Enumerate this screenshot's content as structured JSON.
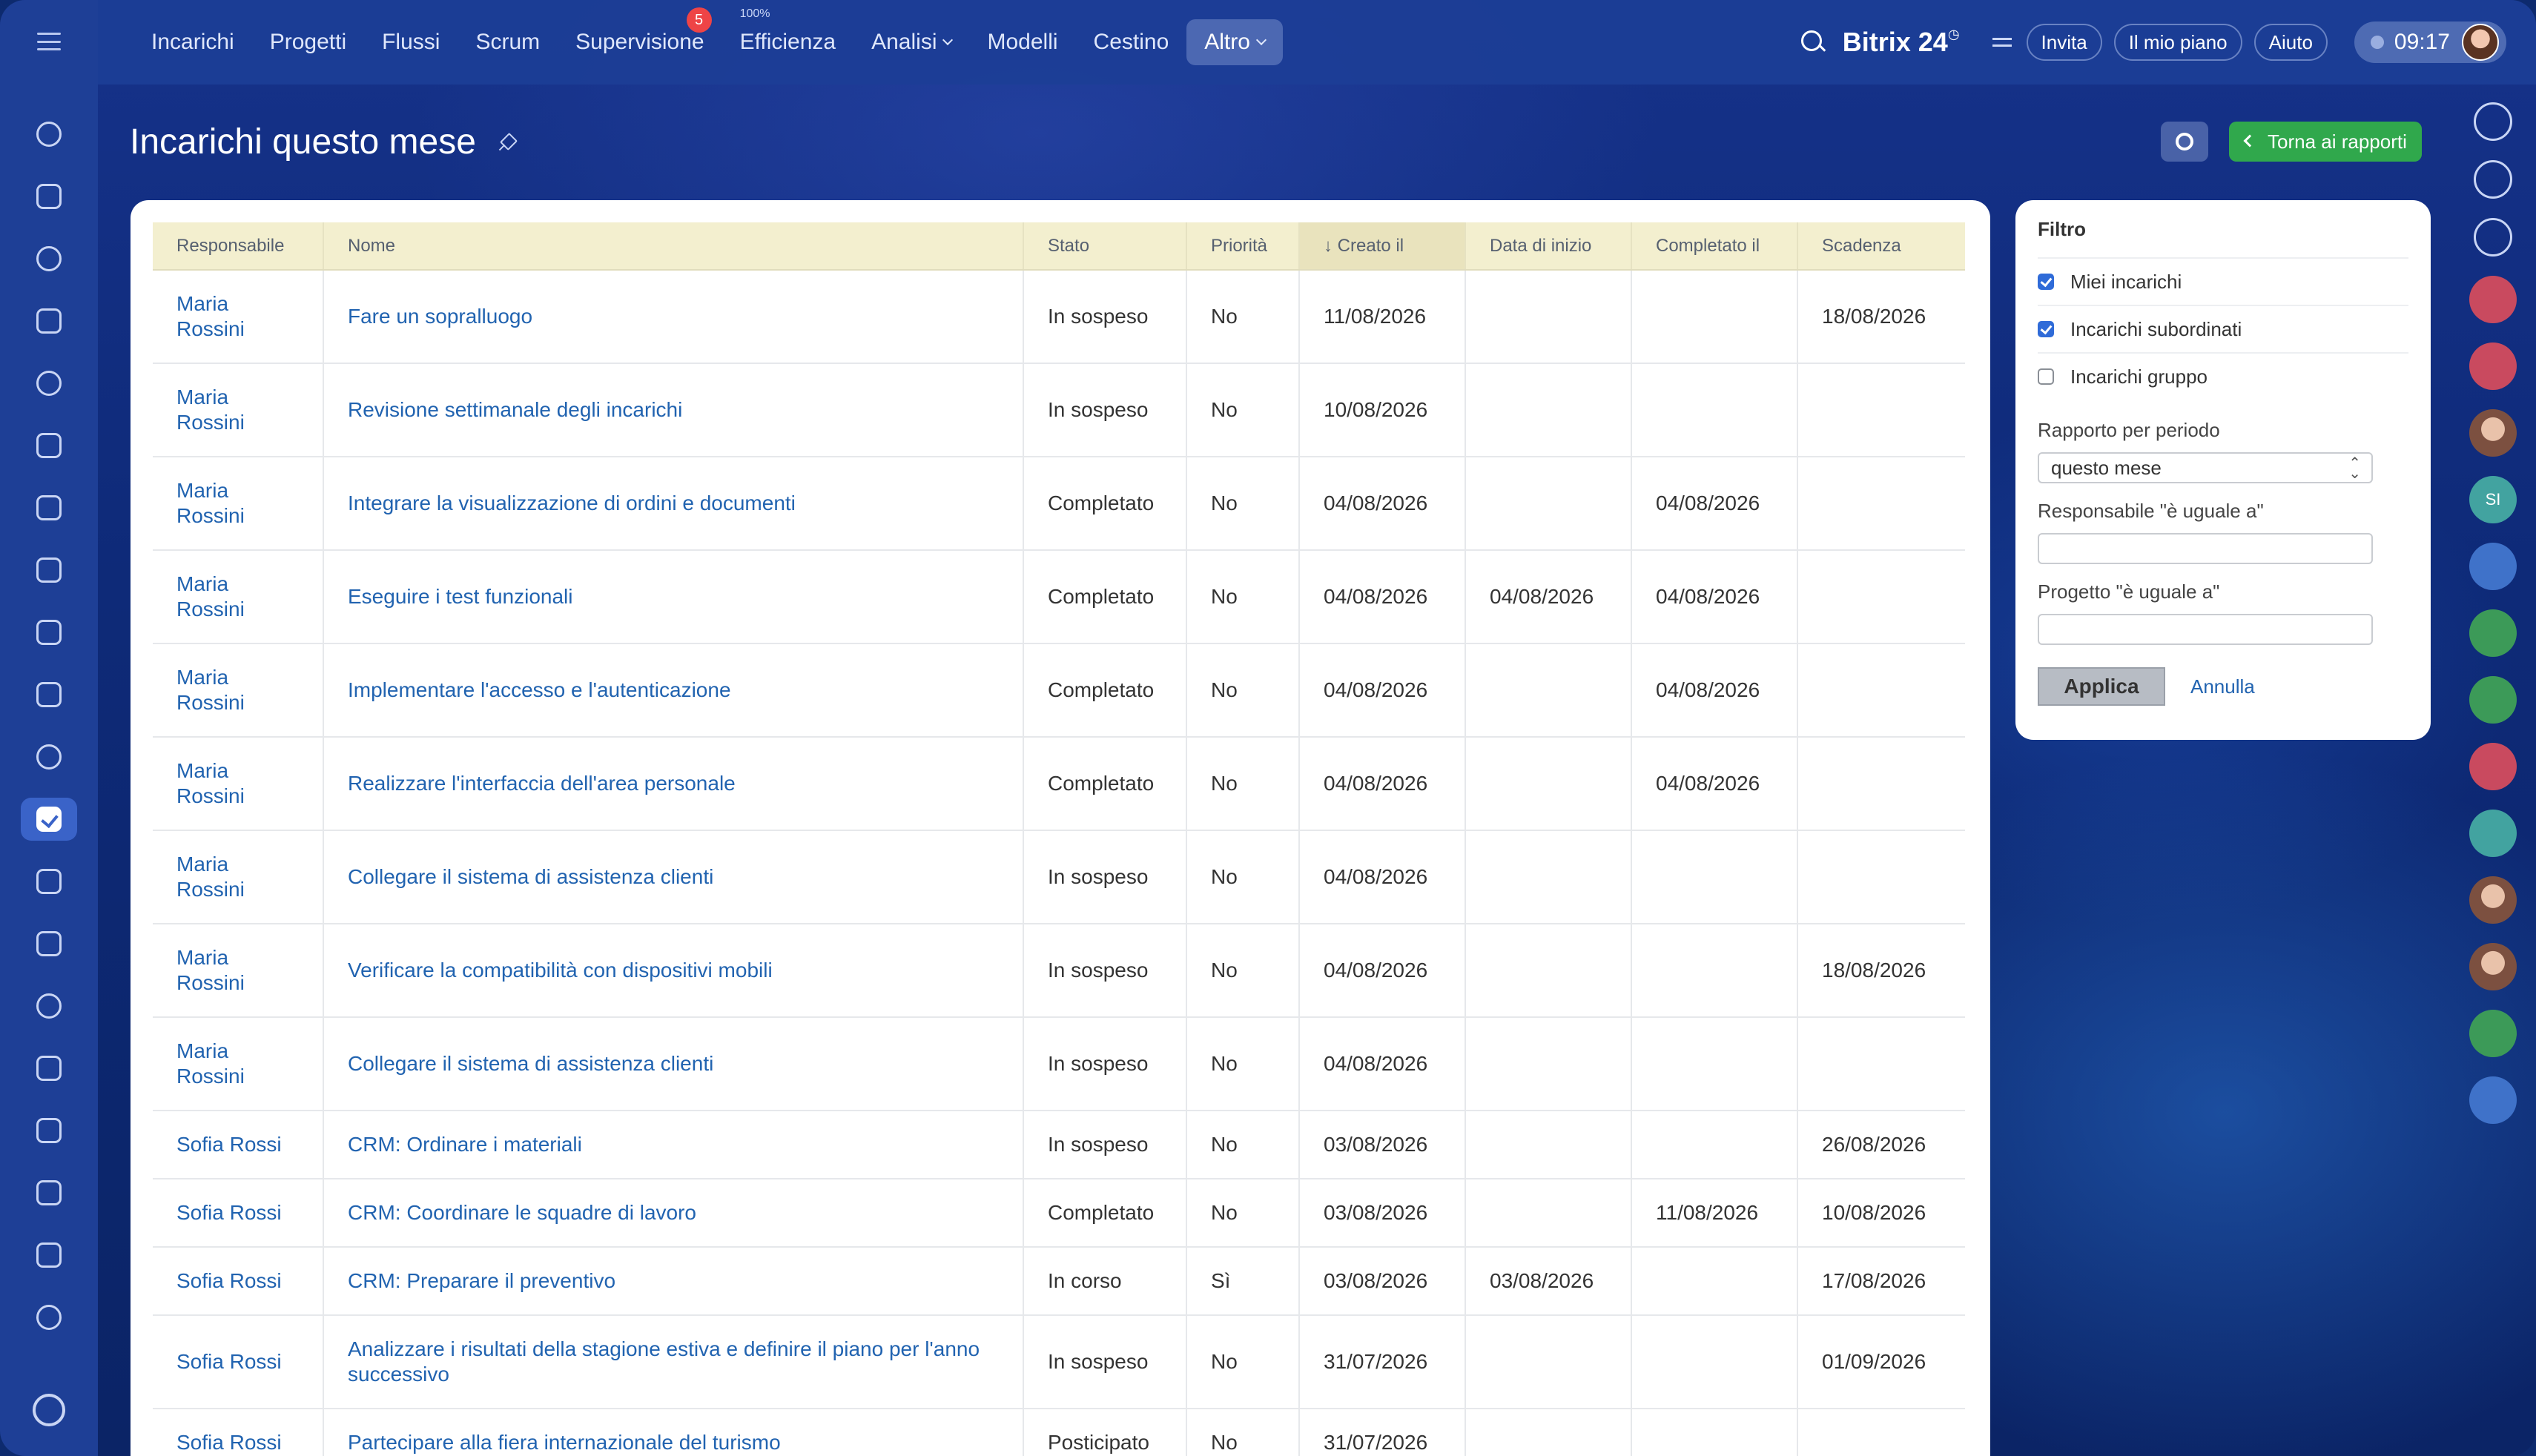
{
  "nav": {
    "items": [
      {
        "label": "Incarichi"
      },
      {
        "label": "Progetti"
      },
      {
        "label": "Flussi"
      },
      {
        "label": "Scrum"
      },
      {
        "label": "Supervisione",
        "badge": "5"
      },
      {
        "label": "Efficienza",
        "sup": "100%"
      },
      {
        "label": "Analisi"
      },
      {
        "label": "Modelli"
      },
      {
        "label": "Cestino"
      },
      {
        "label": "Altro"
      }
    ],
    "brand": "Bitrix 24",
    "invite": "Invita",
    "plan": "Il mio piano",
    "help": "Aiuto",
    "time": "09:17"
  },
  "page": {
    "title": "Incarichi questo mese",
    "back_button": "Torna ai rapporti"
  },
  "table": {
    "headers": [
      "Responsabile",
      "Nome",
      "Stato",
      "Priorità",
      "↓ Creato il",
      "Data di inizio",
      "Completato il",
      "Scadenza"
    ],
    "rows": [
      [
        "Maria Rossini",
        "Fare un sopralluogo",
        "In sospeso",
        "No",
        "11/08/2026",
        "",
        "",
        "18/08/2026"
      ],
      [
        "Maria Rossini",
        "Revisione settimanale degli incarichi",
        "In sospeso",
        "No",
        "10/08/2026",
        "",
        "",
        ""
      ],
      [
        "Maria Rossini",
        "Integrare la visualizzazione di ordini e documenti",
        "Completato",
        "No",
        "04/08/2026",
        "",
        "04/08/2026",
        ""
      ],
      [
        "Maria Rossini",
        "Eseguire i test funzionali",
        "Completato",
        "No",
        "04/08/2026",
        "04/08/2026",
        "04/08/2026",
        ""
      ],
      [
        "Maria Rossini",
        "Implementare l'accesso e l'autenticazione",
        "Completato",
        "No",
        "04/08/2026",
        "",
        "04/08/2026",
        ""
      ],
      [
        "Maria Rossini",
        "Realizzare l'interfaccia dell'area personale",
        "Completato",
        "No",
        "04/08/2026",
        "",
        "04/08/2026",
        ""
      ],
      [
        "Maria Rossini",
        "Collegare il sistema di assistenza clienti",
        "In sospeso",
        "No",
        "04/08/2026",
        "",
        "",
        ""
      ],
      [
        "Maria Rossini",
        "Verificare la compatibilità con dispositivi mobili",
        "In sospeso",
        "No",
        "04/08/2026",
        "",
        "",
        "18/08/2026"
      ],
      [
        "Maria Rossini",
        "Collegare il sistema di assistenza clienti",
        "In sospeso",
        "No",
        "04/08/2026",
        "",
        "",
        ""
      ],
      [
        "Sofia Rossi",
        "CRM: Ordinare i materiali",
        "In sospeso",
        "No",
        "03/08/2026",
        "",
        "",
        "26/08/2026"
      ],
      [
        "Sofia Rossi",
        "CRM: Coordinare le squadre di lavoro",
        "Completato",
        "No",
        "03/08/2026",
        "",
        "11/08/2026",
        "10/08/2026"
      ],
      [
        "Sofia Rossi",
        "CRM: Preparare il preventivo",
        "In corso",
        "Sì",
        "03/08/2026",
        "03/08/2026",
        "",
        "17/08/2026"
      ],
      [
        "Sofia Rossi",
        "Analizzare i risultati della stagione estiva e definire il piano per l'anno successivo",
        "In sospeso",
        "No",
        "31/07/2026",
        "",
        "",
        "01/09/2026"
      ],
      [
        "Sofia Rossi",
        "Partecipare alla fiera internazionale del turismo",
        "Posticipato",
        "No",
        "31/07/2026",
        "",
        "",
        ""
      ]
    ]
  },
  "filter": {
    "title": "Filtro",
    "checks": [
      {
        "label": "Miei incarichi"
      },
      {
        "label": "Incarichi subordinati"
      },
      {
        "label": "Incarichi gruppo"
      }
    ],
    "period_label": "Rapporto per periodo",
    "period_value": "questo mese",
    "responsible_label": "Responsabile \"è uguale a\"",
    "project_label": "Progetto \"è uguale a\"",
    "apply": "Applica",
    "cancel": "Annulla"
  },
  "rightbar": {
    "si_label": "SI"
  }
}
